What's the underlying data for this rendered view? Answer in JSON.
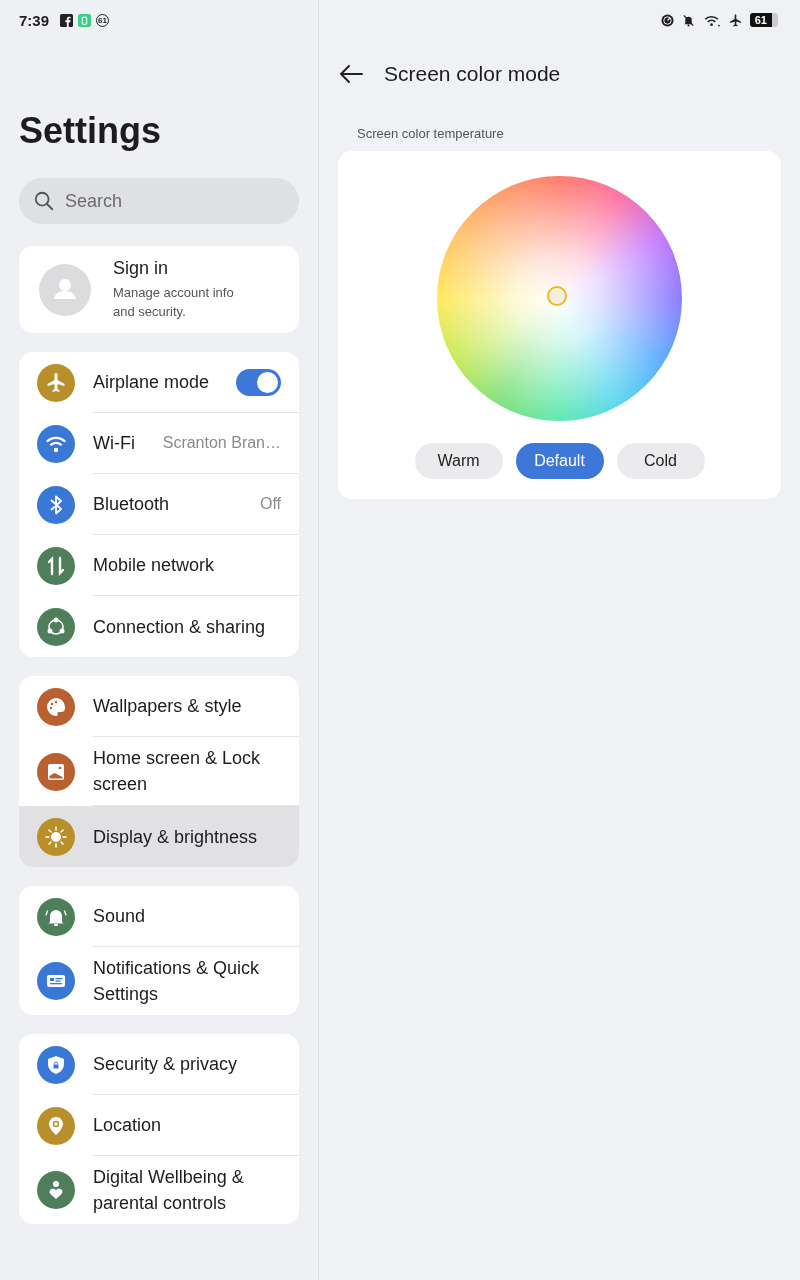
{
  "status_bar": {
    "time": "7:39",
    "notification_count": "61",
    "battery": "61"
  },
  "sidebar": {
    "title": "Settings",
    "search": {
      "placeholder": "Search"
    },
    "account": {
      "title": "Sign in",
      "subtitle": "Manage account info and security."
    },
    "groups": [
      {
        "items": [
          {
            "label": "Airplane mode",
            "kind": "toggle",
            "on": true,
            "selected": false,
            "color": "#b88f2a"
          },
          {
            "label": "Wi-Fi",
            "kind": "value",
            "value": "Scranton Bran…",
            "selected": false,
            "color": "#3a78d6"
          },
          {
            "label": "Bluetooth",
            "kind": "value",
            "value": "Off",
            "selected": false,
            "color": "#3a78d6"
          },
          {
            "label": "Mobile network",
            "kind": "plain",
            "selected": false,
            "color": "#4e7f5a"
          },
          {
            "label": "Connection & sharing",
            "kind": "plain",
            "selected": false,
            "color": "#4e7f5a"
          }
        ]
      },
      {
        "items": [
          {
            "label": "Wallpapers & style",
            "kind": "plain",
            "selected": false,
            "color": "#b8602f"
          },
          {
            "label": "Home screen & Lock screen",
            "kind": "plain",
            "selected": false,
            "color": "#b8602f"
          },
          {
            "label": "Display & brightness",
            "kind": "plain",
            "selected": true,
            "color": "#b88f2a"
          }
        ]
      },
      {
        "items": [
          {
            "label": "Sound",
            "kind": "plain",
            "selected": false,
            "color": "#4e7f5a"
          },
          {
            "label": "Notifications & Quick Settings",
            "kind": "plain",
            "selected": false,
            "color": "#3a78d6"
          }
        ]
      },
      {
        "items": [
          {
            "label": "Security & privacy",
            "kind": "plain",
            "selected": false,
            "color": "#3a78d6"
          },
          {
            "label": "Location",
            "kind": "plain",
            "selected": false,
            "color": "#b88f2a"
          },
          {
            "label": "Digital Wellbeing & parental controls",
            "kind": "plain",
            "selected": false,
            "color": "#4e7f5a"
          }
        ]
      }
    ]
  },
  "detail": {
    "title": "Screen color mode",
    "section_label": "Screen color temperature",
    "presets": [
      {
        "label": "Warm",
        "selected": false
      },
      {
        "label": "Default",
        "selected": true
      },
      {
        "label": "Cold",
        "selected": false
      }
    ]
  }
}
